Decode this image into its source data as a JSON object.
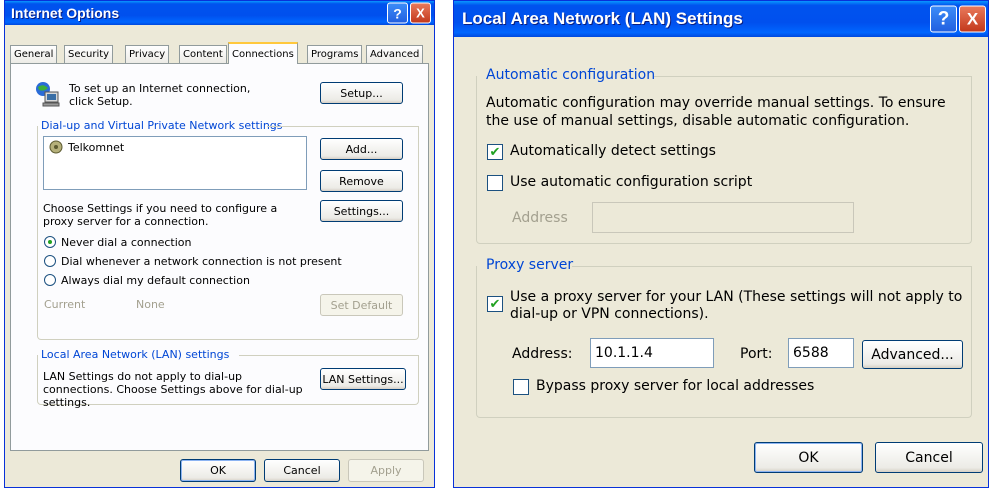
{
  "internet_options": {
    "title": "Internet Options",
    "help_label": "?",
    "close_label": "X",
    "tabs": [
      "General",
      "Security",
      "Privacy",
      "Content",
      "Connections",
      "Programs",
      "Advanced"
    ],
    "setup_text": "To set up an Internet connection, click Setup.",
    "setup_button": "Setup...",
    "dialup_group": "Dial-up and Virtual Private Network settings",
    "connections": [
      "Telkomnet"
    ],
    "add_button": "Add...",
    "remove_button": "Remove",
    "settings_text": "Choose Settings if you need to configure a proxy server for a connection.",
    "settings_button": "Settings...",
    "radio_never": "Never dial a connection",
    "radio_whenever": "Dial whenever a network connection is not present",
    "radio_always": "Always dial my default connection",
    "current_label": "Current",
    "current_value": "None",
    "set_default_button": "Set Default",
    "lan_group": "Local Area Network (LAN) settings",
    "lan_text": "LAN Settings do not apply to dial-up connections. Choose Settings above for dial-up settings.",
    "lan_button": "LAN Settings...",
    "ok_button": "OK",
    "cancel_button": "Cancel",
    "apply_button": "Apply"
  },
  "lan_settings": {
    "title": "Local Area Network (LAN) Settings",
    "help_label": "?",
    "close_label": "X",
    "auto_group": "Automatic configuration",
    "auto_text": "Automatic configuration may override manual settings.  To ensure the use of manual settings, disable automatic configuration.",
    "auto_detect_label": "Automatically detect settings",
    "auto_script_label": "Use automatic configuration script",
    "script_address_label": "Address",
    "script_address_value": "",
    "proxy_group": "Proxy server",
    "use_proxy_label": "Use a proxy server for your LAN (These settings will not apply to dial-up or VPN connections).",
    "address_label": "Address:",
    "address_value": "10.1.1.4",
    "port_label": "Port:",
    "port_value": "6588",
    "advanced_button": "Advanced...",
    "bypass_label": "Bypass proxy server for local addresses",
    "ok_button": "OK",
    "cancel_button": "Cancel"
  },
  "check_glyph": "✔"
}
